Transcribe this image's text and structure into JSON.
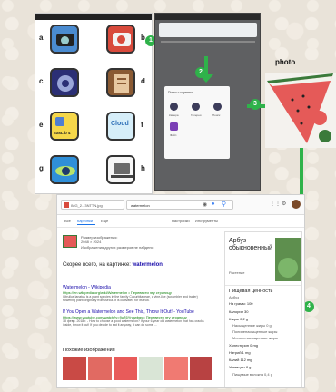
{
  "tiles": [
    {
      "letter": "a",
      "colors": [
        "#4a8bd0",
        "#222"
      ]
    },
    {
      "letter": "b",
      "colors": [
        "#d84a3c",
        "#f2f2f2"
      ]
    },
    {
      "letter": "c",
      "colors": [
        "#2b2f75",
        "#9aa6d8"
      ]
    },
    {
      "letter": "d",
      "colors": [
        "#8a5a33",
        "#e7c8a1"
      ]
    },
    {
      "letter": "e",
      "colors": [
        "#f5d74a",
        "#4f7fd3"
      ],
      "text": "EasLib 4"
    },
    {
      "letter": "f",
      "colors": [
        "#5a9fe0",
        "#d6eef9"
      ],
      "text": "Cloud"
    },
    {
      "letter": "g",
      "colors": [
        "#2f8fd8",
        "#b7e36b"
      ]
    },
    {
      "letter": "h",
      "colors": [
        "#6a6a6a",
        "#f6f6f6"
      ]
    }
  ],
  "steps": [
    "1",
    "2",
    "3",
    "4"
  ],
  "photo": {
    "label": "photo"
  },
  "chrome": {
    "dialog_title": "Поиск с картинки",
    "options": [
      "Камера",
      "Галерея",
      "Поиск",
      "Файл"
    ]
  },
  "result": {
    "tab_title": "IMG_2...3NTTN.jpg",
    "query": "watermelon",
    "tabs": [
      "Все",
      "Картинки",
      "Ещё",
      "Настройки",
      "Инструменты"
    ],
    "size_label": "Размер изображения:",
    "size_value": "2048 × 2024",
    "no_other_sizes": "Изображения других размеров не найдены",
    "best_guess_prefix": "Скорее всего, на картинке:",
    "best_guess": "watermelon",
    "results": [
      {
        "title": "Watermelon - Wikipedia",
        "url": "https://en.wikipedia.org/wiki/Watermelon • Перевести эту страницу",
        "snippet": "Citrullus lanatus is a plant species in the family Cucurbitaceae, a vine-like (scrambler and trailer) flowering plant originally from Africa. It is cultivated for its fruit."
      },
      {
        "title": "If You Open a Watermelon and See This, Throw It Out! - YouTube",
        "url": "https://www.youtube.com/watch?v=9uZ6Ynqwbgy • Перевести эту страницу",
        "snippet": "18 февр. 2018 г. - How to choose a good watermelon? If your 6 year old watermelon that has cracks inside, throw it out! If you decide to eat it anyway, it can do some ..."
      }
    ],
    "similar_title": "Похожие изображения",
    "kp": {
      "title": "Арбуз обыкновенный",
      "subtitle": "Растение",
      "nutrition_title": "Пищевая ценность",
      "nutrition_sub": "Арбуз",
      "rows": [
        "Калории 30",
        "Жиры 0,2 g",
        "Насыщенные жиры 0 g",
        "Полиненасыщенные жиры",
        "Мононенасыщенные жиры",
        "Холестерин 0 mg",
        "Натрий 1 mg",
        "Калий 112 mg",
        "Углеводы 8 g",
        "Пищевые волокна 0,4 g"
      ],
      "portion": "На грамм: 100"
    }
  }
}
